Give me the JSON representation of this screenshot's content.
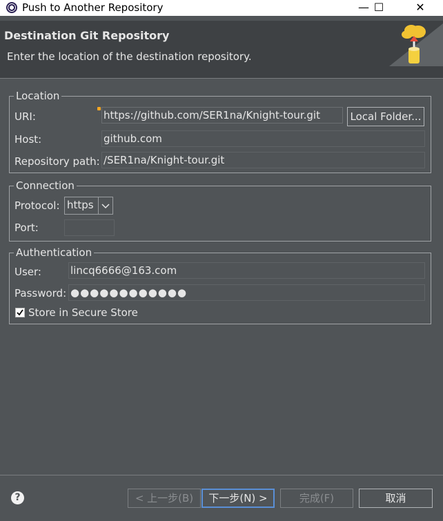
{
  "window": {
    "title": "Push to Another Repository",
    "minimize_glyph": "—",
    "maximize_glyph": "☐",
    "close_glyph": "✕"
  },
  "banner": {
    "heading": "Destination Git Repository",
    "description": "Enter the location of the destination repository."
  },
  "location": {
    "legend": "Location",
    "uri_label": "URI:",
    "uri_value": "https://github.com/SER1na/Knight-tour.git",
    "local_folder_button": "Local Folder...",
    "host_label": "Host:",
    "host_value": "github.com",
    "repo_path_label": "Repository path:",
    "repo_path_value": "/SER1na/Knight-tour.git"
  },
  "connection": {
    "legend": "Connection",
    "protocol_label": "Protocol:",
    "protocol_value": "https",
    "port_label": "Port:",
    "port_value": ""
  },
  "authentication": {
    "legend": "Authentication",
    "user_label": "User:",
    "user_value": "lincq6666@163.com",
    "password_label": "Password:",
    "password_value": "●●●●●●●●●●●●",
    "store_label": "Store in Secure Store",
    "store_checked": true
  },
  "footer": {
    "help_glyph": "?",
    "back_button": "< 上一步(B)",
    "next_button": "下一步(N) >",
    "finish_button": "完成(F)",
    "cancel_button": "取消"
  }
}
